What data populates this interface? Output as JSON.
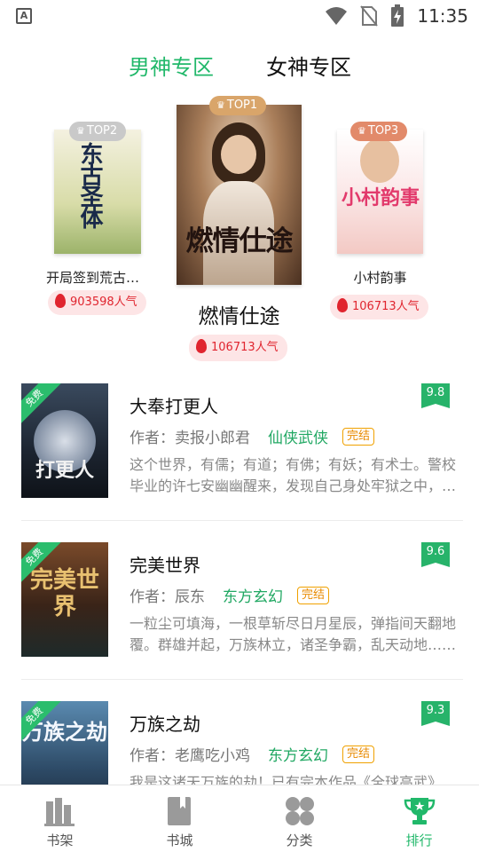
{
  "status_bar": {
    "time": "11:35",
    "left_icon_letter": "A"
  },
  "zone_tabs": [
    {
      "label": "男神专区",
      "active": true
    },
    {
      "label": "女神专区",
      "active": false
    }
  ],
  "podium": {
    "top1": {
      "badge": "TOP1",
      "title": "燃情仕途",
      "cover_text": "燃情仕途",
      "popularity": "106713人气"
    },
    "top2": {
      "badge": "TOP2",
      "title": "开局签到荒古圣...",
      "cover_text": "东古圣体",
      "popularity": "903598人气"
    },
    "top3": {
      "badge": "TOP3",
      "title": "小村韵事",
      "cover_text": "小村韵事",
      "popularity": "106713人气"
    }
  },
  "books": [
    {
      "title": "大奉打更人",
      "author_label": "作者：",
      "author": "卖报小郎君",
      "category": "仙侠武侠",
      "status": "完结",
      "score": "9.8",
      "free_label": "免费",
      "cover_text": "打更人",
      "description": "这个世界，有儒；有道；有佛；有妖；有术士。警校毕业的许七安幽幽醒来，发现自己身处牢狱之中，三日后流放边陲……"
    },
    {
      "title": "完美世界",
      "author_label": "作者：",
      "author": "辰东",
      "category": "东方玄幻",
      "status": "完结",
      "score": "9.6",
      "free_label": "免费",
      "cover_text": "完美世界",
      "description": "一粒尘可填海，一根草斩尽日月星辰，弹指间天翻地覆。群雄并起，万族林立，诸圣争霸，乱天动地……"
    },
    {
      "title": "万族之劫",
      "author_label": "作者：",
      "author": "老鹰吃小鸡",
      "category": "东方玄幻",
      "status": "完结",
      "score": "9.3",
      "free_label": "免费",
      "cover_text": "万族之劫",
      "description": "我是这诸天万族的劫！已有完本作品《全球高武》"
    }
  ],
  "bottom_nav": [
    {
      "label": "书架",
      "icon": "bookshelf-icon",
      "active": false
    },
    {
      "label": "书城",
      "icon": "bookstore-icon",
      "active": false
    },
    {
      "label": "分类",
      "icon": "category-icon",
      "active": false
    },
    {
      "label": "排行",
      "icon": "trophy-icon",
      "active": true
    }
  ],
  "colors": {
    "accent": "#21b86a",
    "popularity": "#e0252f",
    "badge_gold": "#d9a56a",
    "badge_silver": "#c8c8c8",
    "badge_bronze": "#e28a6a"
  }
}
